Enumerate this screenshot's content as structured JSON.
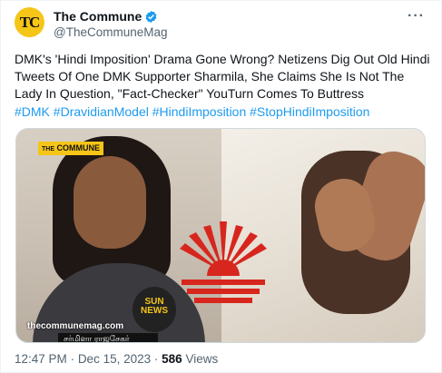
{
  "author": {
    "avatar_initials": "TC",
    "display_name": "The Commune",
    "handle": "@TheCommuneMag",
    "more_icon": "more-horizontal-icon"
  },
  "tweet": {
    "text_lines": [
      "DMK's 'Hindi Imposition' Drama Gone Wrong? Netizens Dig Out Old Hindi",
      "Tweets Of One DMK Supporter Sharmila, She Claims She Is Not The",
      "Lady In Question, \"Fact-Checker\" YouTurn Comes To Buttress"
    ],
    "hashtags": [
      "#DMK",
      "#DravidianModel",
      "#HindiImposition",
      "#StopHindiImposition"
    ]
  },
  "media": {
    "brand_badge_the": "THE",
    "brand_badge_name": "COMMUNE",
    "mic_label_1": "SUN",
    "mic_label_2": "NEWS",
    "website": "thecommunemag.com",
    "caption": "சர்மிளா ராஜசேகர்"
  },
  "meta": {
    "time": "12:47 PM",
    "date": "Dec 15, 2023",
    "views_count": "586",
    "views_label": "Views"
  },
  "colors": {
    "link": "#1d9bf0",
    "secondary": "#536471",
    "brand_yellow": "#f5c518",
    "dmk_red": "#d7261e"
  }
}
